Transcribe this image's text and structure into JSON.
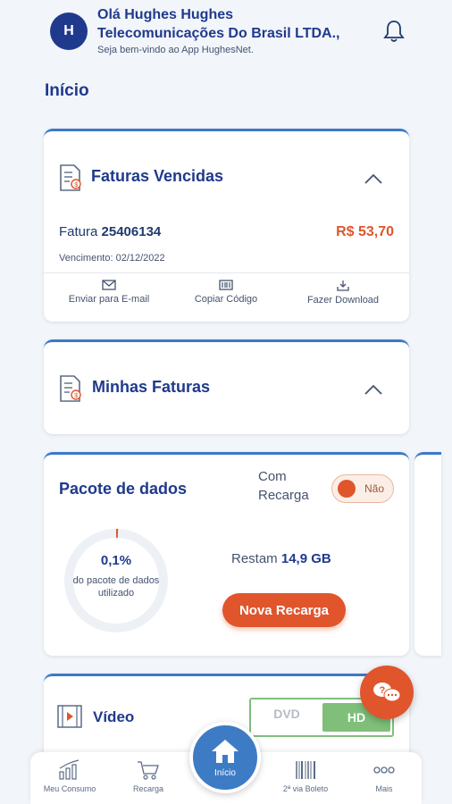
{
  "header": {
    "avatar_initial": "H",
    "greeting_line1": "Olá Hughes Hughes",
    "greeting_line2": "Telecomunicações Do Brasil LTDA.,",
    "welcome": "Seja bem-vindo ao App HughesNet."
  },
  "page_title": "Início",
  "overdue": {
    "title": "Faturas Vencidas",
    "invoice_label": "Fatura",
    "invoice_number": "25406134",
    "amount": "R$ 53,70",
    "due_date": "Vencimento: 02/12/2022",
    "actions": [
      {
        "label": "Enviar para E-mail",
        "icon": "mail-icon"
      },
      {
        "label": "Copiar Código",
        "icon": "barcode-icon"
      },
      {
        "label": "Fazer Download",
        "icon": "download-icon"
      }
    ]
  },
  "my_invoices": {
    "title": "Minhas Faturas"
  },
  "data_package": {
    "title": "Pacote de dados",
    "recharge_label": "Com Recarga",
    "toggle_label": "Não",
    "used_percent": "0,1%",
    "used_fraction": 0.001,
    "used_caption": "do pacote de dados utilizado",
    "remaining_label": "Restam",
    "remaining_value": "14,9 GB",
    "recharge_button": "Nova Recarga"
  },
  "video": {
    "title": "Vídeo",
    "option_dvd": "DVD",
    "option_hd": "HD",
    "selected": "HD"
  },
  "bottom_nav": {
    "items": [
      {
        "label": "Meu Consumo",
        "icon": "chart-icon"
      },
      {
        "label": "Recarga",
        "icon": "cart-icon"
      },
      {
        "label": "Início",
        "icon": "home-icon"
      },
      {
        "label": "2ª via Boleto",
        "icon": "barcode-icon"
      },
      {
        "label": "Mais",
        "icon": "more-icon"
      }
    ]
  },
  "colors": {
    "primary": "#1f3a8c",
    "accent": "#e0552b",
    "link_blue": "#3c79c8",
    "hd_green": "#7fbf7a"
  }
}
